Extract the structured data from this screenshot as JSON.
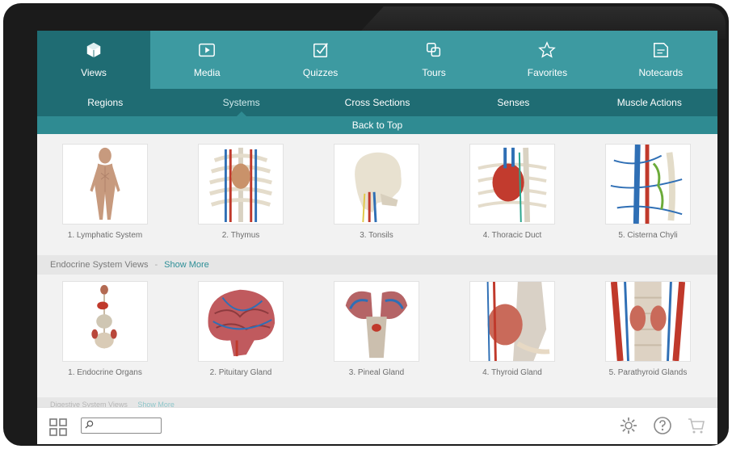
{
  "tabs": [
    {
      "label": "Views",
      "icon": "cube-icon"
    },
    {
      "label": "Media",
      "icon": "play-icon"
    },
    {
      "label": "Quizzes",
      "icon": "checkbox-icon"
    },
    {
      "label": "Tours",
      "icon": "tours-icon"
    },
    {
      "label": "Favorites",
      "icon": "star-icon"
    },
    {
      "label": "Notecards",
      "icon": "notecard-icon"
    }
  ],
  "subnav": [
    "Regions",
    "Systems",
    "Cross Sections",
    "Senses",
    "Muscle Actions"
  ],
  "back_to_top": "Back to Top",
  "lymphatic": {
    "items": [
      "1. Lymphatic System",
      "2. Thymus",
      "3. Tonsils",
      "4. Thoracic Duct",
      "5. Cisterna Chyli"
    ]
  },
  "endocrine": {
    "header": "Endocrine System Views",
    "dash": "-",
    "show_more": "Show More",
    "items": [
      "1. Endocrine Organs",
      "2. Pituitary Gland",
      "3. Pineal Gland",
      "4. Thyroid Gland",
      "5. Parathyroid Glands"
    ]
  },
  "next_section": {
    "header": "Digestive System Views",
    "show_more": "Show More"
  },
  "search": {
    "value": "",
    "placeholder": ""
  },
  "colors": {
    "nav": "#3d9aa1",
    "nav_active": "#1f6c73",
    "accent": "#2e8f97",
    "artery": "#c0392b",
    "vein": "#2f6fb5"
  }
}
